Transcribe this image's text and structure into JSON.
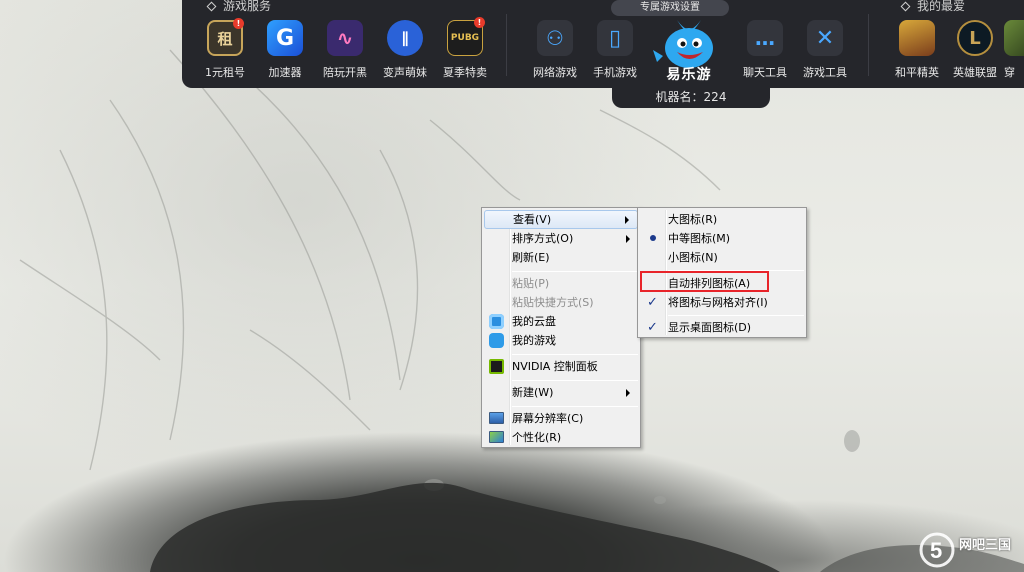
{
  "launcher": {
    "service_title": "游戏服务",
    "favorites_title": "我的最爱",
    "apps": [
      {
        "label": "1元租号",
        "icon": "rent-account-icon",
        "glyph": "租",
        "badge": "!"
      },
      {
        "label": "加速器",
        "icon": "accelerator-icon",
        "glyph": "G"
      },
      {
        "label": "陪玩开黑",
        "icon": "companion-play-icon",
        "glyph": "∿"
      },
      {
        "label": "变声萌妹",
        "icon": "voice-changer-icon",
        "glyph": "∥"
      },
      {
        "label": "夏季特卖",
        "icon": "pubg-sale-icon",
        "glyph": "PUBG",
        "badge": "!"
      },
      {
        "label": "网络游戏",
        "icon": "gamepad-icon",
        "glyph": "⚇"
      },
      {
        "label": "手机游戏",
        "icon": "mobile-phone-icon",
        "glyph": "▯"
      },
      {
        "label": "聊天工具",
        "icon": "chat-bubble-icon",
        "glyph": "…"
      },
      {
        "label": "游戏工具",
        "icon": "crossed-swords-icon",
        "glyph": "✕"
      },
      {
        "label": "和平精英",
        "icon": "peace-elite-icon",
        "glyph": ""
      },
      {
        "label": "英雄联盟",
        "icon": "league-of-legends-icon",
        "glyph": "L"
      },
      {
        "label": "穿",
        "icon": "crossfire-icon",
        "glyph": ""
      }
    ],
    "mascot_tooltip": "专属游戏设置",
    "mascot_logo": "易乐游",
    "machine_name": "机器名：224"
  },
  "context_menu": {
    "items": [
      {
        "label": "查看(V)",
        "has_submenu": true,
        "highlighted": true
      },
      {
        "label": "排序方式(O)",
        "has_submenu": true
      },
      {
        "label": "刷新(E)"
      },
      {
        "label": "粘贴(P)",
        "disabled": true
      },
      {
        "label": "粘贴快捷方式(S)",
        "disabled": true
      },
      {
        "label": "我的云盘",
        "icon": "cloud-disk-icon"
      },
      {
        "label": "我的游戏",
        "icon": "my-games-icon"
      },
      {
        "label": "NVIDIA 控制面板",
        "icon": "nvidia-icon"
      },
      {
        "label": "新建(W)",
        "has_submenu": true
      },
      {
        "label": "屏幕分辨率(C)",
        "icon": "screen-resolution-icon"
      },
      {
        "label": "个性化(R)",
        "icon": "personalize-icon"
      }
    ]
  },
  "view_submenu": {
    "items": [
      {
        "label": "大图标(R)"
      },
      {
        "label": "中等图标(M)",
        "selected": true
      },
      {
        "label": "小图标(N)"
      },
      {
        "label": "自动排列图标(A)",
        "annotated": true
      },
      {
        "label": "将图标与网格对齐(I)",
        "checked": true
      },
      {
        "label": "显示桌面图标(D)",
        "checked": true
      }
    ]
  },
  "watermark": {
    "line1": "网吧三国",
    "line2": "5"
  },
  "colors": {
    "annotation_red": "#e8242a",
    "menu_check": "#1c3a8c",
    "bar_bg": "#25262b"
  }
}
